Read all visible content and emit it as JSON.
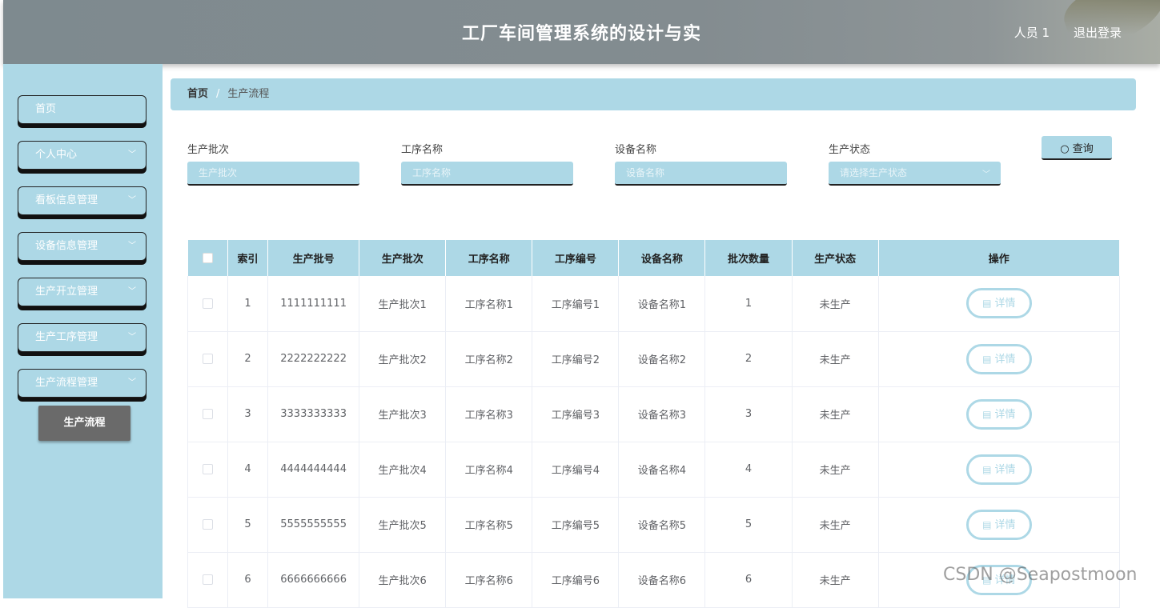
{
  "header": {
    "title": "工厂车间管理系统的设计与实",
    "user": "人员 1",
    "logout": "退出登录"
  },
  "sidebar": {
    "items": [
      {
        "label": "首页",
        "has_chevron": false
      },
      {
        "label": "个人中心",
        "has_chevron": true
      },
      {
        "label": "看板信息管理",
        "has_chevron": true
      },
      {
        "label": "设备信息管理",
        "has_chevron": true
      },
      {
        "label": "生产开立管理",
        "has_chevron": true
      },
      {
        "label": "生产工序管理",
        "has_chevron": true
      },
      {
        "label": "生产流程管理",
        "has_chevron": true
      }
    ],
    "submenu_active": "生产流程"
  },
  "breadcrumb": {
    "home": "首页",
    "separator": "/",
    "current": "生产流程"
  },
  "search": {
    "batch_label": "生产批次",
    "batch_placeholder": "生产批次",
    "process_label": "工序名称",
    "process_placeholder": "工序名称",
    "device_label": "设备名称",
    "device_placeholder": "设备名称",
    "status_label": "生产状态",
    "status_placeholder": "请选择生产状态",
    "query_button": "查询"
  },
  "table": {
    "headers": [
      "索引",
      "生产批号",
      "生产批次",
      "工序名称",
      "工序编号",
      "设备名称",
      "批次数量",
      "生产状态",
      "操作"
    ],
    "detail_label": "详情",
    "rows": [
      [
        "1",
        "1111111111",
        "生产批次1",
        "工序名称1",
        "工序编号1",
        "设备名称1",
        "1",
        "未生产"
      ],
      [
        "2",
        "2222222222",
        "生产批次2",
        "工序名称2",
        "工序编号2",
        "设备名称2",
        "2",
        "未生产"
      ],
      [
        "3",
        "3333333333",
        "生产批次3",
        "工序名称3",
        "工序编号3",
        "设备名称3",
        "3",
        "未生产"
      ],
      [
        "4",
        "4444444444",
        "生产批次4",
        "工序名称4",
        "工序编号4",
        "设备名称4",
        "4",
        "未生产"
      ],
      [
        "5",
        "5555555555",
        "生产批次5",
        "工序名称5",
        "工序编号5",
        "设备名称5",
        "5",
        "未生产"
      ],
      [
        "6",
        "6666666666",
        "生产批次6",
        "工序名称6",
        "工序编号6",
        "设备名称6",
        "6",
        "未生产"
      ]
    ]
  },
  "watermark": "CSDN @Seapostmoon",
  "colors": {
    "accent": "#add8e6",
    "header": "#838c90",
    "submenu": "#6a6a6a"
  }
}
